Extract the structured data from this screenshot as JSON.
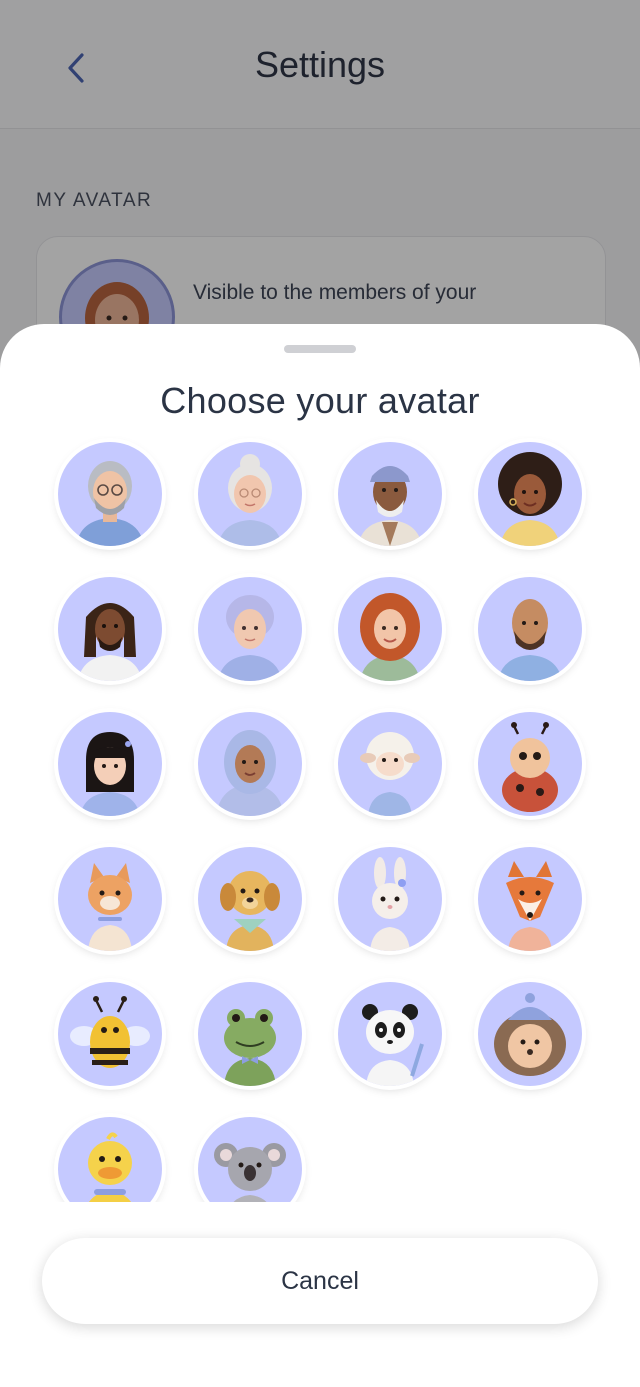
{
  "header": {
    "title": "Settings",
    "back_icon": "chevron-left-icon"
  },
  "section": {
    "label": "MY AVATAR"
  },
  "card": {
    "text": "Visible to the members of your"
  },
  "sheet": {
    "title": "Choose your avatar",
    "cancel_label": "Cancel",
    "avatars": [
      "older-man-glasses-avatar",
      "older-woman-bun-avatar",
      "older-man-cap-avatar",
      "woman-afro-avatar",
      "man-dreadlocks-avatar",
      "older-woman-lilac-hair-avatar",
      "woman-red-curly-hair-avatar",
      "bald-man-beard-avatar",
      "girl-black-hair-avatar",
      "woman-hijab-avatar",
      "sheep-avatar",
      "ladybug-avatar",
      "cat-avatar",
      "dog-avatar",
      "bunny-avatar",
      "fox-avatar",
      "bee-avatar",
      "frog-avatar",
      "panda-avatar",
      "hedgehog-avatar",
      "duck-avatar",
      "koala-avatar"
    ]
  },
  "colors": {
    "avatar_bg": "#c5c9ff",
    "text": "#2b3445",
    "accent": "#8d95d8"
  }
}
